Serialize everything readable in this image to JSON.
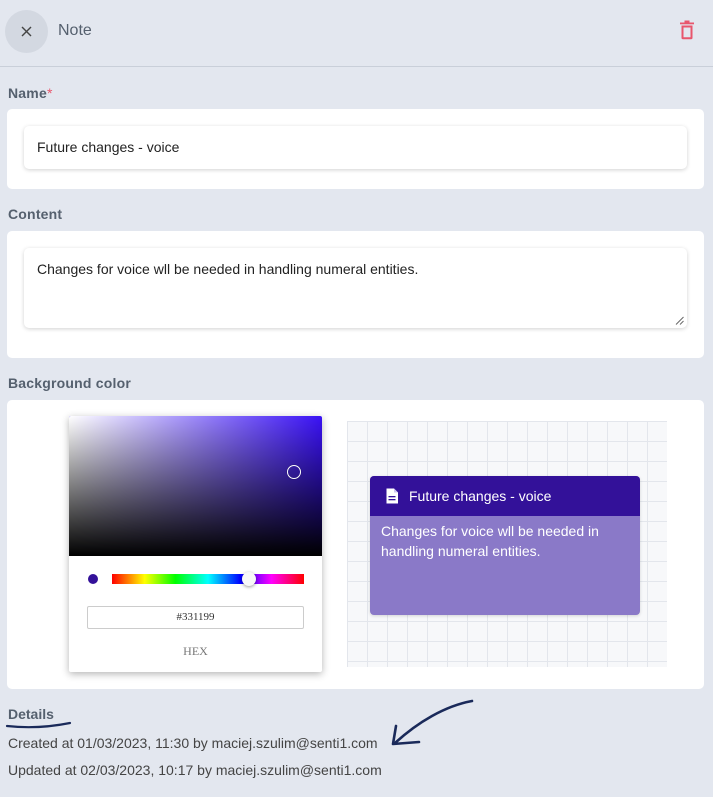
{
  "header": {
    "title": "Note",
    "close_icon": "close-icon",
    "delete_icon": "trash-icon"
  },
  "name_field": {
    "label": "Name",
    "required_mark": "*",
    "value": "Future changes - voice"
  },
  "content_field": {
    "label": "Content",
    "value": "Changes for voice wll be needed in handling numeral entities."
  },
  "background_color": {
    "label": "Background color",
    "hex_value": "#331199",
    "format_label": "HEX",
    "hue_color": "#3a12f5"
  },
  "preview": {
    "title": "Future changes - voice",
    "body": "Changes for voice wll be needed in handling numeral entities.",
    "icon": "document-icon",
    "header_color": "#331199",
    "body_color": "#8a79c8"
  },
  "details": {
    "title": "Details",
    "created": "Created at 01/03/2023, 11:30 by maciej.szulim@senti1.com",
    "updated": "Updated at 02/03/2023, 10:17 by maciej.szulim@senti1.com"
  },
  "colors": {
    "accent_delete": "#e8566c",
    "page_bg": "#e3e7ef",
    "annotation": "#1a2a5a"
  }
}
